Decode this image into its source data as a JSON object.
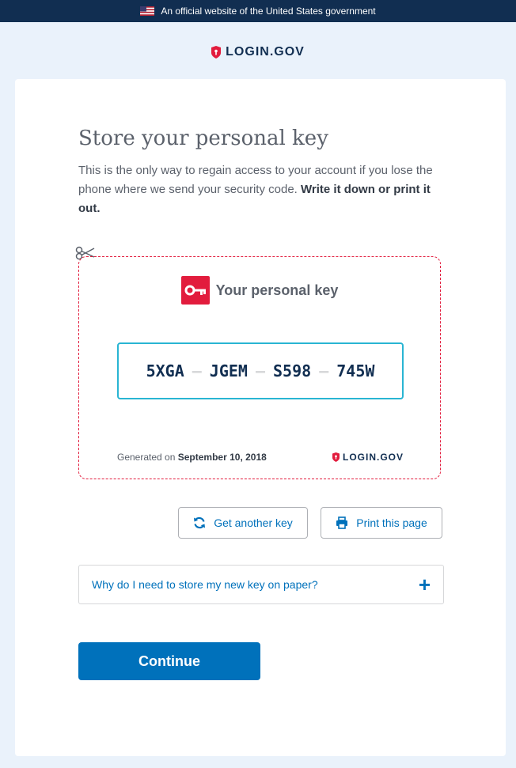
{
  "banner": {
    "text": "An official website of the United States government"
  },
  "brand": {
    "name": "LOGIN.GOV"
  },
  "page": {
    "title": "Store your personal key",
    "intro_text": "This is the only way to regain access to your account if you lose the phone where we send your security code.",
    "intro_bold": "Write it down or print it out."
  },
  "key_card": {
    "heading": "Your personal key",
    "code": [
      "5XGA",
      "JGEM",
      "S598",
      "745W"
    ],
    "separator": "–",
    "generated_label": "Generated on",
    "generated_date": "September 10, 2018",
    "brand": "LOGIN.GOV"
  },
  "actions": {
    "get_another_key": "Get another key",
    "print_page": "Print this page"
  },
  "accordion": {
    "label": "Why do I need to store my new key on paper?"
  },
  "continue_label": "Continue",
  "colors": {
    "navy": "#112e51",
    "brand_red": "#e21c3d",
    "link_blue": "#0071bb",
    "code_border": "#29b5d3",
    "page_bg": "#eaf2fb"
  },
  "icons": [
    "us-flag-icon",
    "shield-icon",
    "scissors-icon",
    "key-icon",
    "refresh-icon",
    "printer-icon",
    "plus-icon"
  ]
}
